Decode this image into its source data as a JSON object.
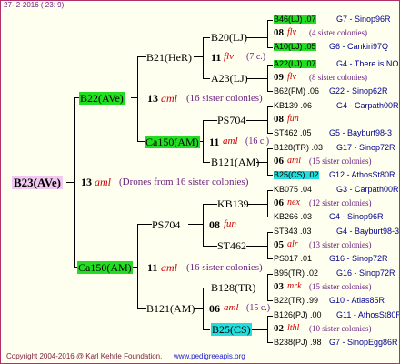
{
  "header": {
    "date": "27- 2-2016 ( 23: 9)"
  },
  "footer": {
    "copyright": "Copyright 2004-2016 @ Karl Kehrle Foundation.",
    "site": "www.pedigreeapis.org"
  },
  "root": {
    "name": "B23(AVe)",
    "num": "13",
    "tag": "aml",
    "note": "(Drones from 16 sister colonies)"
  },
  "l1": [
    {
      "name": "B22(AVe)",
      "num": "13",
      "tag": "aml",
      "note": "(16 sister colonies)"
    },
    {
      "name": "Ca150(AM)",
      "num": "11",
      "tag": "aml",
      "note": "(16 sister colonies)"
    }
  ],
  "l2": [
    {
      "name": "B21(HeR)",
      "num": "11",
      "tag": "flv",
      "note": "(7 c.)"
    },
    {
      "name": "Ca150(AM)",
      "num": "11",
      "tag": "aml",
      "note": "(16 c.)"
    },
    {
      "name": "PS704",
      "num": "08",
      "tag": "fun",
      "note": ""
    },
    {
      "name": "B121(AM)",
      "num": "06",
      "tag": "aml",
      "note": "(15 c.)"
    }
  ],
  "l3": [
    "B20(LJ)",
    "A23(LJ)",
    "PS704",
    "B121(AM)",
    "KB139",
    "ST462",
    "B128(TR)",
    "B25(CS)"
  ],
  "l4": [
    {
      "a": "B46(LJ) .07",
      "a_id": "G7 - Sinop96R",
      "num": "08",
      "tag": "flv",
      "note": "(4 sister colonies)",
      "b": "A10(LJ) .05",
      "b_id": "G6 - Cankiri97Q"
    },
    {
      "a": "A22(LJ) .07",
      "a_id": "G4 - There is NO",
      "num": "09",
      "tag": "flv",
      "note": "(8 sister colonies)",
      "b": "B62(FM) .06",
      "b_id": "G22 - Sinop62R"
    },
    {
      "a": "KB139 .06",
      "a_id": "G4 - Carpath00R",
      "num": "08",
      "tag": "fun",
      "note": "",
      "b": "ST462 .05",
      "b_id": "G5 - Bayburt98-3"
    },
    {
      "a": "B128(TR) .03",
      "a_id": "G17 - Sinop72R",
      "num": "06",
      "tag": "aml",
      "note": "(15 sister colonies)",
      "b": "B25(CS) .02",
      "b_id": "G12 - AthosSt80R"
    },
    {
      "a": "KB075 .04",
      "a_id": "G3 - Carpath00R",
      "num": "06",
      "tag": "nex",
      "note": "(12 sister colonies)",
      "b": "KB266 .03",
      "b_id": "G4 - Sinop96R"
    },
    {
      "a": "ST343 .03",
      "a_id": "G4 - Bayburt98-3",
      "num": "05",
      "tag": "alr",
      "note": "(13 sister colonies)",
      "b": "PS017 .01",
      "b_id": "G16 - Sinop72R"
    },
    {
      "a": "B95(TR) .02",
      "a_id": "G16 - Sinop72R",
      "num": "03",
      "tag": "mrk",
      "note": "(15 sister colonies)",
      "b": "B22(TR) .99",
      "b_id": "G10 - Atlas85R"
    },
    {
      "a": "B126(PJ) .00",
      "a_id": "G11 - AthosSt80R",
      "num": "02",
      "tag": "lthl",
      "note": "(10 sister colonies)",
      "b": "B238(PJ) .98",
      "b_id": "G7 - SinopEgg86R"
    }
  ]
}
